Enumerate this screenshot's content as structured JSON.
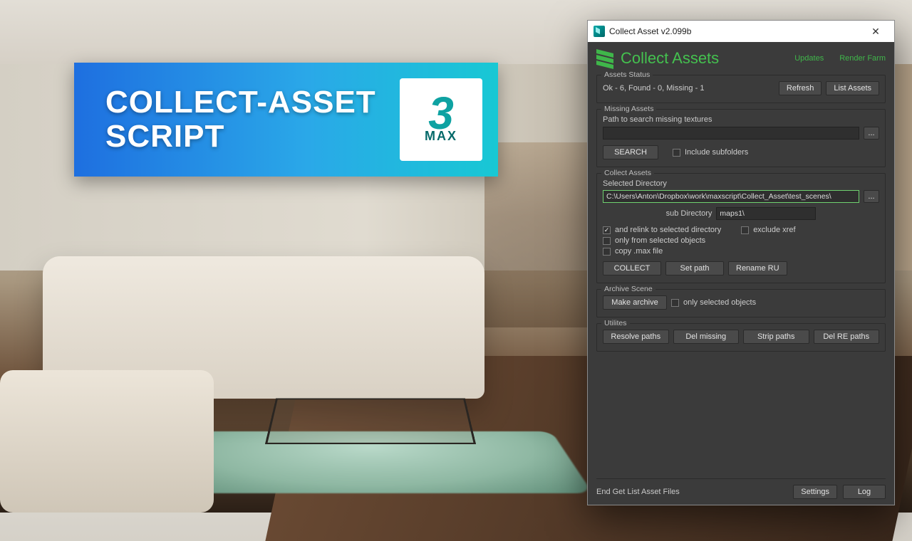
{
  "banner": {
    "line1": "COLLECT-ASSET",
    "line2": "SCRIPT",
    "logo_big": "3",
    "logo_small": "MAX"
  },
  "window": {
    "title": "Collect Asset v2.099b",
    "close": "✕"
  },
  "header": {
    "title": "Collect Assets",
    "link_updates": "Updates",
    "link_renderfarm": "Render Farm"
  },
  "status": {
    "group": "Assets Status",
    "text": "Ok - 6, Found - 0, Missing - 1",
    "refresh": "Refresh",
    "list": "List Assets"
  },
  "missing": {
    "group": "Missing Assets",
    "label": "Path to search missing textures",
    "path": "",
    "browse": "...",
    "search": "SEARCH",
    "subfolders": "Include subfolders"
  },
  "collect": {
    "group": "Collect Assets",
    "sel_label": "Selected Directory",
    "sel_path": "C:\\Users\\Anton\\Dropbox\\work\\maxscript\\Collect_Asset\\test_scenes\\",
    "browse": "...",
    "sub_label": "sub Directory",
    "sub_value": "maps1\\",
    "chk_relink": "and relink to selected directory",
    "chk_xref": "exclude xref",
    "chk_only_sel": "only from selected objects",
    "chk_copy_max": "copy .max file",
    "btn_collect": "COLLECT",
    "btn_setpath": "Set path",
    "btn_rename": "Rename RU"
  },
  "archive": {
    "group": "Archive Scene",
    "btn": "Make archive",
    "chk": "only selected objects"
  },
  "util": {
    "group": "Utilites",
    "resolve": "Resolve paths",
    "delmissing": "Del missing",
    "strip": "Strip paths",
    "delre": "Del RE paths"
  },
  "footer": {
    "status": "End Get List Asset Files",
    "settings": "Settings",
    "log": "Log"
  }
}
